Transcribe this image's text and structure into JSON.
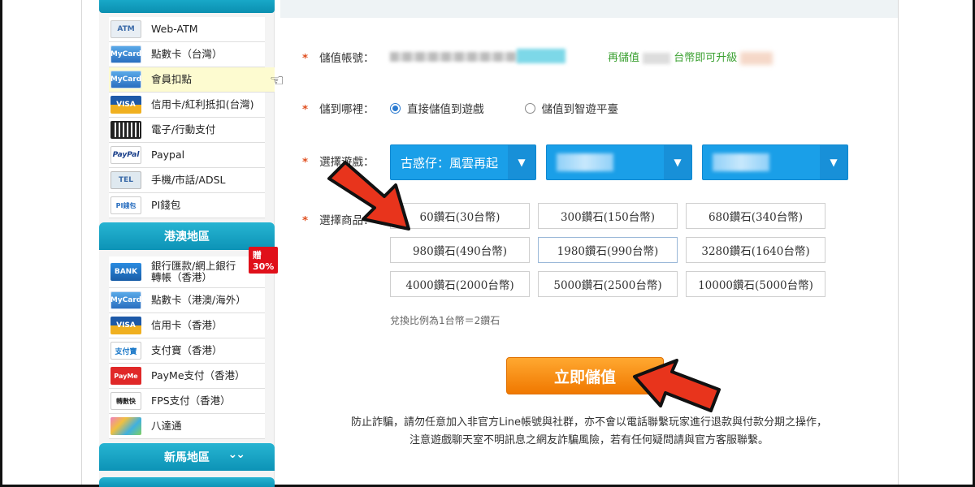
{
  "sidebar": {
    "taiwan_items": [
      {
        "label": "Web-ATM",
        "icon": "webatm-icon",
        "logo_text": "ATM"
      },
      {
        "label": "點數卡（台灣）",
        "icon": "mycard-icon",
        "logo_text": "MyCard"
      },
      {
        "label": "會員扣點",
        "icon": "mycard-icon",
        "logo_text": "MyCard",
        "active": true
      },
      {
        "label": "信用卡/紅利抵扣(台灣)",
        "icon": "visa-icon",
        "logo_text": "VISA"
      },
      {
        "label": "電子/行動支付",
        "icon": "qrcode-icon",
        "logo_text": ""
      },
      {
        "label": "Paypal",
        "icon": "paypal-icon",
        "logo_text": "PayPal"
      },
      {
        "label": "手機/市話/ADSL",
        "icon": "phone-icon",
        "logo_text": "TEL"
      },
      {
        "label": "PI錢包",
        "icon": "piwallet-icon",
        "logo_text": "PI錢包"
      }
    ],
    "hk_header": "港澳地區",
    "hk_badge": "贈30%",
    "hk_items": [
      {
        "label": "銀行匯款/網上銀行轉帳（香港）",
        "icon": "bank-icon",
        "logo_text": "BANK"
      },
      {
        "label": "點數卡（港澳/海外）",
        "icon": "mycard-icon",
        "logo_text": "MyCard"
      },
      {
        "label": "信用卡（香港）",
        "icon": "visa-icon",
        "logo_text": "VISA"
      },
      {
        "label": "支付寶（香港）",
        "icon": "alipay-icon",
        "logo_text": "支付寶"
      },
      {
        "label": "PayMe支付（香港）",
        "icon": "payme-icon",
        "logo_text": "PayMe"
      },
      {
        "label": "FPS支付（香港）",
        "icon": "fps-icon",
        "logo_text": "轉數快"
      },
      {
        "label": "八達通",
        "icon": "octopus-icon",
        "logo_text": ""
      }
    ],
    "sea_header": "新馬地區"
  },
  "form": {
    "account_label": "儲值帳號：",
    "upgrade_prefix": "再儲值",
    "upgrade_suffix": "台幣即可升級",
    "target_label": "儲到哪裡：",
    "target_options": [
      "直接儲值到遊戲",
      "儲值到智遊平臺"
    ],
    "game_label": "選擇遊戲：",
    "game_select": "古惑仔：風雲再起",
    "product_label": "選擇商品：",
    "products": [
      "60鑽石(30台幣)",
      "300鑽石(150台幣)",
      "680鑽石(340台幣)",
      "980鑽石(490台幣)",
      "1980鑽石(990台幣)",
      "3280鑽石(1640台幣)",
      "4000鑽石(2000台幣)",
      "5000鑽石(2500台幣)",
      "10000鑽石(5000台幣)"
    ],
    "ratio_text": "兌換比例為1台幣＝2鑽石",
    "submit_label": "立即儲值",
    "notice_line1": "防止詐騙，請勿任意加入非官方Line帳號與社群，亦不會以電話聯繫玩家進行退款與付款分期之操作，",
    "notice_line2": "注意遊戲聊天室不明訊息之網友詐騙風險，若有任何疑問請與官方客服聯繫。"
  },
  "colors": {
    "accent": "#1a9fe8",
    "submit": "#f59010",
    "arrow": "#e8341c",
    "header": "#14a4c6"
  }
}
